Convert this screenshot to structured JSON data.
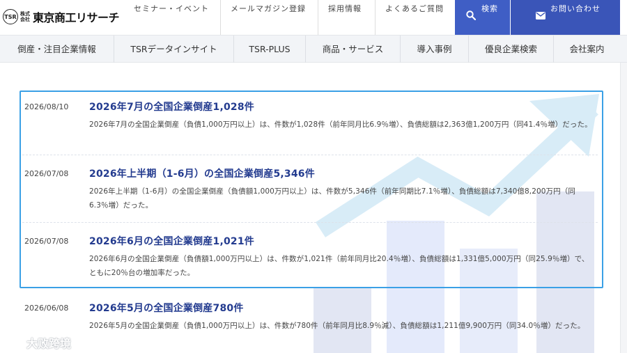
{
  "header": {
    "logo_mark": "TSR",
    "logo_sub": "株式会社",
    "logo_text": "東京商工リサーチ",
    "links": [
      {
        "label": "セミナー・イベント"
      },
      {
        "label": "メールマガジン登録"
      },
      {
        "label": "採用情報"
      },
      {
        "label": "よくあるご質問"
      }
    ],
    "search_label": "検索",
    "contact_label": "お問い合わせ"
  },
  "nav": {
    "items": [
      {
        "label": "倒産・注目企業情報"
      },
      {
        "label": "TSRデータインサイト"
      },
      {
        "label": "TSR-PLUS"
      },
      {
        "label": "商品・サービス"
      },
      {
        "label": "導入事例"
      },
      {
        "label": "優良企業検索"
      },
      {
        "label": "会社案内"
      }
    ]
  },
  "news": [
    {
      "date": "2026/08/10",
      "title": "2026年7月の全国企業倒産1,028件",
      "body": "2026年7月の全国企業倒産（負債1,000万円以上）は、件数が1,028件（前年同月比6.9％増）、負債総額は2,363億1,200万円（同41.4％増）だった。"
    },
    {
      "date": "2026/07/08",
      "title": "2026年上半期（1-6月）の全国企業倒産5,346件",
      "body": "2026年上半期（1-6月）の全国企業倒産（負債額1,000万円以上）は、件数が5,346件（前年同期比7.1％増）、負債総額は7,340億8,200万円（同6.3％増）だった。"
    },
    {
      "date": "2026/07/08",
      "title": "2026年6月の全国企業倒産1,021件",
      "body": "2026年6月の全国企業倒産（負債額1,000万円以上）は、件数が1,021件（前年同月比20.4％増）、負債総額は1,331億5,000万円（同25.9％増）で、ともに20％台の増加率だった。"
    },
    {
      "date": "2026/06/08",
      "title": "2026年5月の全国企業倒産780件",
      "body": "2026年5月の全国企業倒産（負債1,000万円以上）は、件数が780件（前年同月比8.9％減）、負債総額は1,211億9,900万円（同34.0％増）だった。"
    }
  ],
  "watermark": {
    "text": "大败跨境"
  },
  "colors": {
    "accent": "#3f5ec5",
    "title": "#233b8f",
    "highlight_border": "#3aa0e6"
  }
}
